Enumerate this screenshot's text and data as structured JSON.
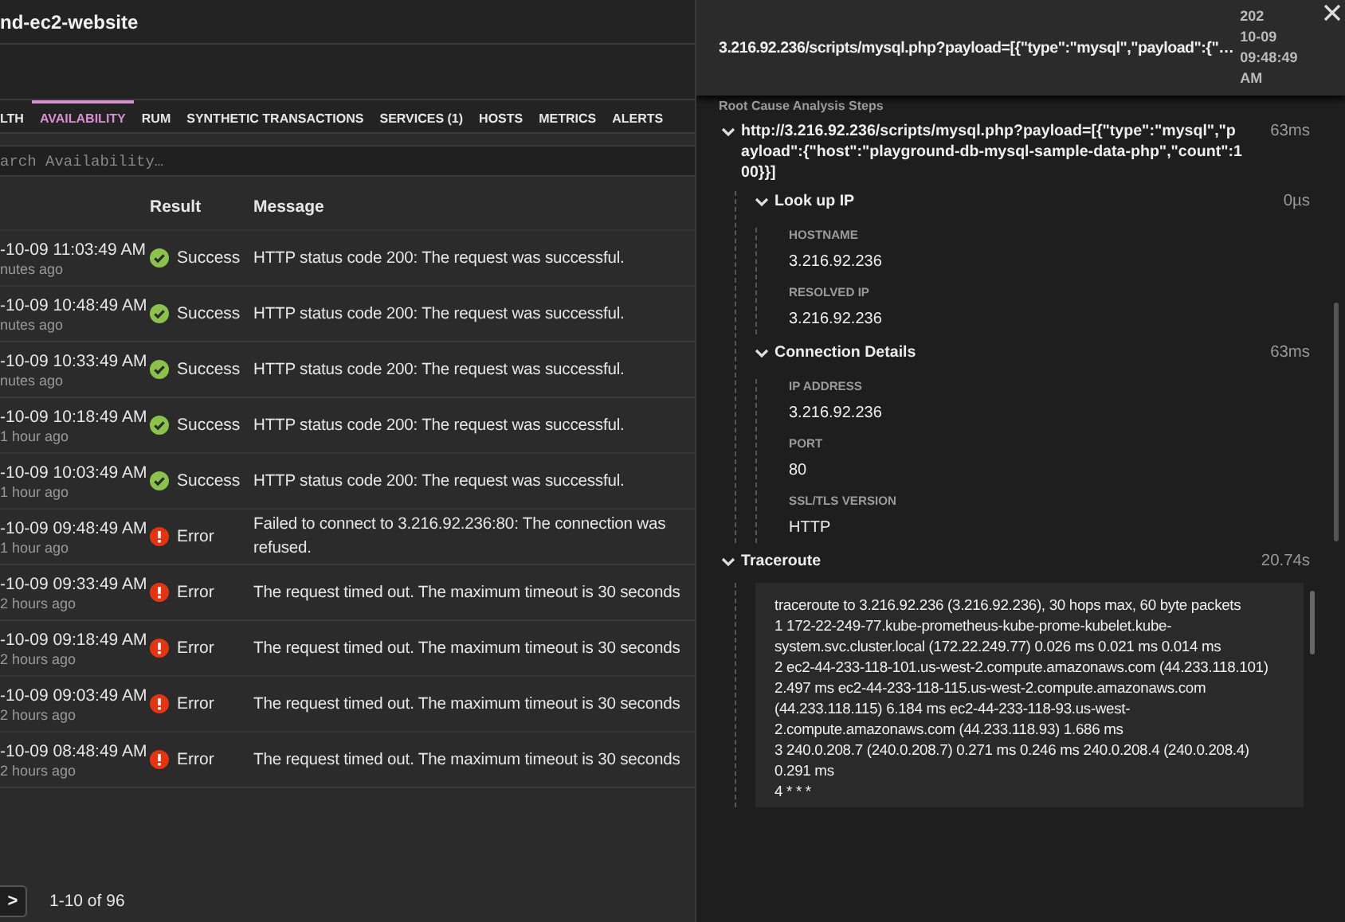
{
  "page_title": "nd-ec2-website",
  "tabs": [
    {
      "label": "LTH",
      "selected": false
    },
    {
      "label": "AVAILABILITY",
      "selected": true
    },
    {
      "label": "RUM",
      "selected": false
    },
    {
      "label": "SYNTHETIC TRANSACTIONS",
      "selected": false
    },
    {
      "label": "SERVICES (1)",
      "selected": false
    },
    {
      "label": "HOSTS",
      "selected": false
    },
    {
      "label": "METRICS",
      "selected": false
    },
    {
      "label": "ALERTS",
      "selected": false
    }
  ],
  "search": {
    "placeholder": "arch Availability…"
  },
  "table": {
    "columns": [
      "Result",
      "Message"
    ],
    "rows": [
      {
        "time": "-10-09 11:03:49 AM",
        "ago": "nutes ago",
        "kind": "success",
        "result": "Success",
        "message": "HTTP status code 200: The request was successful."
      },
      {
        "time": "-10-09 10:48:49 AM",
        "ago": "nutes ago",
        "kind": "success",
        "result": "Success",
        "message": "HTTP status code 200: The request was successful."
      },
      {
        "time": "-10-09 10:33:49 AM",
        "ago": "nutes ago",
        "kind": "success",
        "result": "Success",
        "message": "HTTP status code 200: The request was successful."
      },
      {
        "time": "-10-09 10:18:49 AM",
        "ago": "1 hour ago",
        "kind": "success",
        "result": "Success",
        "message": "HTTP status code 200: The request was successful."
      },
      {
        "time": "-10-09 10:03:49 AM",
        "ago": "1 hour ago",
        "kind": "success",
        "result": "Success",
        "message": "HTTP status code 200: The request was successful."
      },
      {
        "time": "-10-09 09:48:49 AM",
        "ago": "1 hour ago",
        "kind": "error",
        "result": "Error",
        "message": "Failed to connect to 3.216.92.236:80: The connection was refused."
      },
      {
        "time": "-10-09 09:33:49 AM",
        "ago": "2 hours ago",
        "kind": "error",
        "result": "Error",
        "message": "The request timed out. The maximum timeout is 30 seconds"
      },
      {
        "time": "-10-09 09:18:49 AM",
        "ago": "2 hours ago",
        "kind": "error",
        "result": "Error",
        "message": "The request timed out. The maximum timeout is 30 seconds"
      },
      {
        "time": "-10-09 09:03:49 AM",
        "ago": "2 hours ago",
        "kind": "error",
        "result": "Error",
        "message": "The request timed out. The maximum timeout is 30 seconds"
      },
      {
        "time": "-10-09 08:48:49 AM",
        "ago": "2 hours ago",
        "kind": "error",
        "result": "Error",
        "message": "The request timed out. The maximum timeout is 30 seconds"
      }
    ]
  },
  "pagination": {
    "next": ">",
    "range": "1-10 of 96"
  },
  "detail": {
    "title": "3.216.92.236/scripts/mysql.php?payload=[{\"type\":\"mysql\",\"payload\":{\"…",
    "timestamp": [
      "202",
      "10-09",
      "09:48:49",
      "AM"
    ],
    "section_label": "Root Cause Analysis Steps",
    "steps": [
      {
        "title": "http://3.216.92.236/scripts/mysql.php?payload=[{\"type\":\"mysql\",\"payload\":{\"host\":\"playground-db-mysql-sample-data-php\",\"count\":100}}]",
        "duration": "63ms",
        "expanded": true,
        "children": [
          {
            "title": "Look up IP",
            "duration": "0µs",
            "expanded": true,
            "fields": [
              {
                "label": "HOSTNAME",
                "value": "3.216.92.236"
              },
              {
                "label": "RESOLVED IP",
                "value": "3.216.92.236"
              }
            ]
          },
          {
            "title": "Connection Details",
            "duration": "63ms",
            "expanded": true,
            "fields": [
              {
                "label": "IP ADDRESS",
                "value": "3.216.92.236"
              },
              {
                "label": "PORT",
                "value": "80"
              },
              {
                "label": "SSL/TLS VERSION",
                "value": "HTTP"
              }
            ]
          }
        ]
      },
      {
        "title": "Traceroute",
        "duration": "20.74s",
        "expanded": true,
        "output": "traceroute to 3.216.92.236 (3.216.92.236), 30 hops max, 60 byte packets\n1 172-22-249-77.kube-prometheus-kube-prome-kubelet.kube-system.svc.cluster.local (172.22.249.77) 0.026 ms 0.021 ms 0.014 ms\n2 ec2-44-233-118-101.us-west-2.compute.amazonaws.com (44.233.118.101) 2.497 ms ec2-44-233-118-115.us-west-2.compute.amazonaws.com (44.233.118.115) 6.184 ms ec2-44-233-118-93.us-west-2.compute.amazonaws.com (44.233.118.93) 1.686 ms\n3 240.0.208.7 (240.0.208.7) 0.271 ms 0.246 ms 240.0.208.4 (240.0.208.4) 0.291 ms\n4 * * *"
      }
    ]
  }
}
